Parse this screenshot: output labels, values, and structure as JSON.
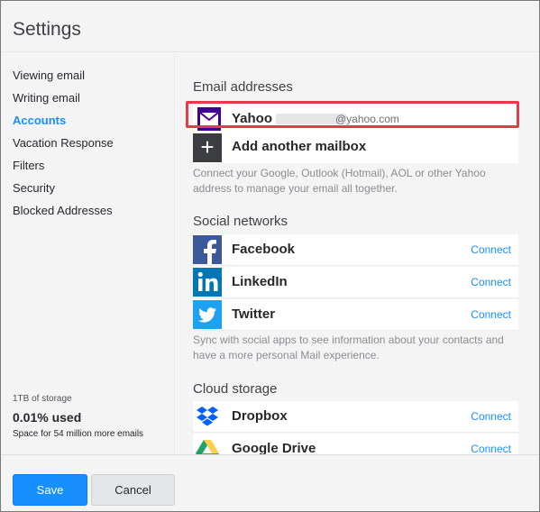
{
  "window": {
    "title": "Settings"
  },
  "sidebar": {
    "items": [
      {
        "label": "Viewing email",
        "active": false
      },
      {
        "label": "Writing email",
        "active": false
      },
      {
        "label": "Accounts",
        "active": true
      },
      {
        "label": "Vacation Response",
        "active": false
      },
      {
        "label": "Filters",
        "active": false
      },
      {
        "label": "Security",
        "active": false
      },
      {
        "label": "Blocked Addresses",
        "active": false
      }
    ],
    "storage": {
      "total": "1TB of storage",
      "used": "0.01% used",
      "space": "Space for 54 million more emails"
    }
  },
  "email_section": {
    "title": "Email addresses",
    "account": {
      "provider": "Yahoo",
      "domain": "@yahoo.com",
      "icon": "envelope-icon"
    },
    "add_label": "Add another mailbox",
    "description": "Connect your Google, Outlook (Hotmail), AOL or other Yahoo address to manage your email all together."
  },
  "social_section": {
    "title": "Social networks",
    "items": [
      {
        "label": "Facebook",
        "action": "Connect",
        "icon": "facebook-icon",
        "color": "#3b5998"
      },
      {
        "label": "LinkedIn",
        "action": "Connect",
        "icon": "linkedin-icon",
        "color": "#0077b5"
      },
      {
        "label": "Twitter",
        "action": "Connect",
        "icon": "twitter-icon",
        "color": "#1da1f2"
      }
    ],
    "description": "Sync with social apps to see information about your contacts and have a more personal Mail experience."
  },
  "cloud_section": {
    "title": "Cloud storage",
    "items": [
      {
        "label": "Dropbox",
        "action": "Connect",
        "icon": "dropbox-icon",
        "color": "#0061fe"
      },
      {
        "label": "Google Drive",
        "action": "Connect",
        "icon": "google-drive-icon"
      }
    ]
  },
  "footer": {
    "save_label": "Save",
    "cancel_label": "Cancel"
  },
  "colors": {
    "accent": "#188fff",
    "highlight": "#e03c49",
    "yahoo_purple": "#400090"
  }
}
